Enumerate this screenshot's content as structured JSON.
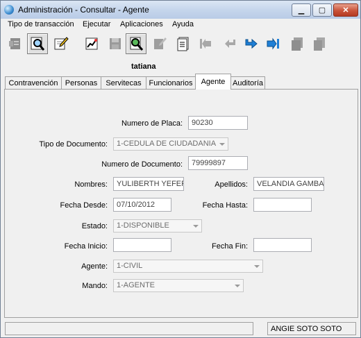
{
  "window": {
    "title": "Administración - Consultar - Agente"
  },
  "menu": [
    "Tipo de transacción",
    "Ejecutar",
    "Aplicaciones",
    "Ayuda"
  ],
  "toolbar": {
    "icons": [
      "new-record-icon",
      "query-icon",
      "edit-icon",
      "chart-icon",
      "save-icon",
      "search-user-icon",
      "delete-icon",
      "document-list-icon",
      "first-record-icon",
      "previous-record-icon",
      "next-record-icon",
      "last-record-icon",
      "print-icon",
      "export-icon"
    ]
  },
  "user_label": "tatiana",
  "tabs": [
    "Contravención",
    "Personas",
    "Servitecas",
    "Funcionarios",
    "Agente",
    "Auditoría"
  ],
  "active_tab": "Agente",
  "form": {
    "numero_placa": {
      "label": "Numero de Placa:",
      "value": "90230"
    },
    "tipo_documento": {
      "label": "Tipo de Documento:",
      "value": "1-CEDULA DE CIUDADANIA"
    },
    "numero_documento": {
      "label": "Numero de Documento:",
      "value": "79999897"
    },
    "nombres": {
      "label": "Nombres:",
      "value": "YULIBERTH YEFERS"
    },
    "apellidos": {
      "label": "Apellidos:",
      "value": "VELANDIA GAMBA"
    },
    "fecha_desde": {
      "label": "Fecha Desde:",
      "value": "07/10/2012"
    },
    "fecha_hasta": {
      "label": "Fecha Hasta:",
      "value": ""
    },
    "estado": {
      "label": "Estado:",
      "value": "1-DISPONIBLE"
    },
    "fecha_inicio": {
      "label": "Fecha Inicio:",
      "value": ""
    },
    "fecha_fin": {
      "label": "Fecha Fin:",
      "value": ""
    },
    "agente": {
      "label": "Agente:",
      "value": "1-CIVIL"
    },
    "mando": {
      "label": "Mando:",
      "value": "1-AGENTE"
    }
  },
  "status": {
    "message": "",
    "user": "ANGIE  SOTO SOTO"
  }
}
